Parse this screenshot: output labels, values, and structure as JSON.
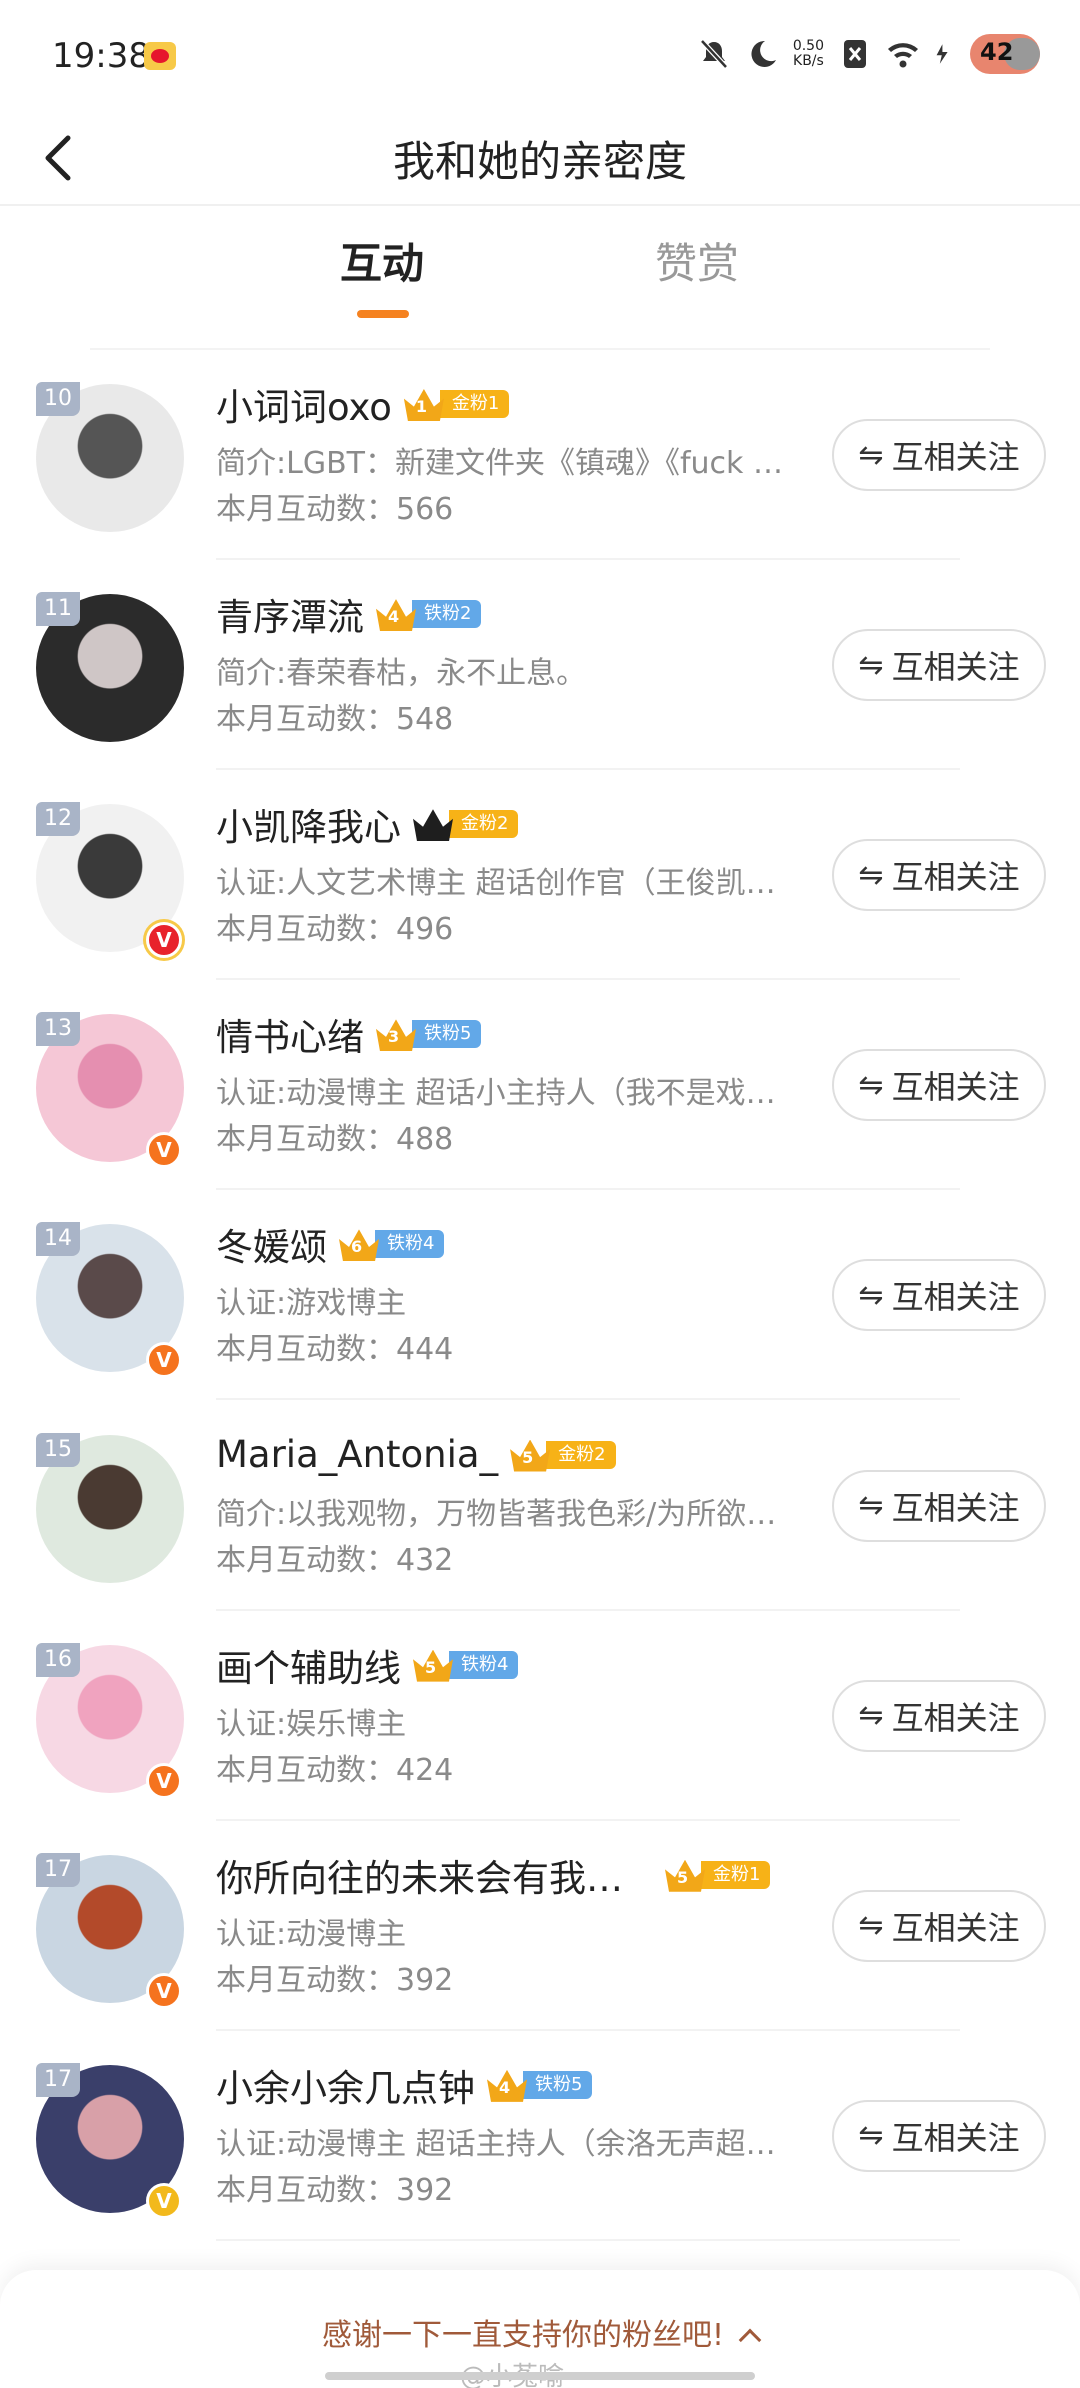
{
  "status_bar": {
    "time": "19:38",
    "net_speed_value": "0.50",
    "net_speed_unit": "KB/s",
    "battery": "42"
  },
  "header": {
    "title": "我和她的亲密度"
  },
  "tabs": [
    {
      "label": "互动",
      "active": true
    },
    {
      "label": "赞赏",
      "active": false
    }
  ],
  "follow_label": "互相关注",
  "list": [
    {
      "rank": "10",
      "name": "小词词oxo",
      "crown": "1",
      "fan": "金粉1",
      "fan_type": "gold",
      "verify": "",
      "desc": "简介:LGBT：新建文件夹《镇魂》《fuck …",
      "count": "本月互动数：566",
      "avatar": [
        "#e9e9e9",
        "#555"
      ]
    },
    {
      "rank": "11",
      "name": "青序潭流",
      "crown": "4",
      "fan": "铁粉2",
      "fan_type": "iron",
      "verify": "",
      "desc": "简介:春荣春枯，永不止息。",
      "count": "本月互动数：548",
      "avatar": [
        "#2b2b2b",
        "#cfc6c6"
      ]
    },
    {
      "rank": "12",
      "name": "小凯降我心",
      "crown": "",
      "fan": "金粉2",
      "fan_type": "gold",
      "verify": "red",
      "desc": "认证:人文艺术博主 超话创作官（王俊凯…",
      "count": "本月互动数：496",
      "avatar": [
        "#f1f1f1",
        "#3a3a3a"
      ]
    },
    {
      "rank": "13",
      "name": "情书心绪",
      "crown": "3",
      "fan": "铁粉5",
      "fan_type": "iron",
      "verify": "orange",
      "desc": "认证:动漫博主 超话小主持人（我不是戏…",
      "count": "本月互动数：488",
      "avatar": [
        "#f5c7d6",
        "#e58fb0"
      ]
    },
    {
      "rank": "14",
      "name": "冬媛颂",
      "crown": "6",
      "fan": "铁粉4",
      "fan_type": "iron",
      "verify": "orange",
      "desc": "认证:游戏博主",
      "count": "本月互动数：444",
      "avatar": [
        "#d9e2ea",
        "#5a4a4a"
      ]
    },
    {
      "rank": "15",
      "name": "Maria_Antonia_",
      "crown": "5",
      "fan": "金粉2",
      "fan_type": "gold",
      "verify": "",
      "desc": "简介:以我观物，万物皆著我色彩/为所欲…",
      "count": "本月互动数：432",
      "avatar": [
        "#dfe9df",
        "#4a3a32"
      ]
    },
    {
      "rank": "16",
      "name": "画个辅助线",
      "crown": "5",
      "fan": "铁粉4",
      "fan_type": "iron",
      "verify": "orange",
      "desc": "认证:娱乐博主",
      "count": "本月互动数：424",
      "avatar": [
        "#f7d8e4",
        "#f0a3bf"
      ]
    },
    {
      "rank": "17",
      "name": "你所向往的未来会有我…",
      "crown": "5",
      "fan": "金粉1",
      "fan_type": "gold",
      "verify": "orange",
      "desc": "认证:动漫博主",
      "count": "本月互动数：392",
      "avatar": [
        "#c9d6e2",
        "#b34a2a"
      ]
    },
    {
      "rank": "17",
      "name": "小余小余几点钟",
      "crown": "4",
      "fan": "铁粉5",
      "fan_type": "iron",
      "verify": "yellow",
      "desc": "认证:动漫博主 超话主持人（余洛无声超…",
      "count": "本月互动数：392",
      "avatar": [
        "#3a3f6a",
        "#d8a0a8"
      ]
    }
  ],
  "bottom": {
    "thanks": "感谢一下一直支持你的粉丝吧!",
    "watermark": "@小菟喻"
  }
}
